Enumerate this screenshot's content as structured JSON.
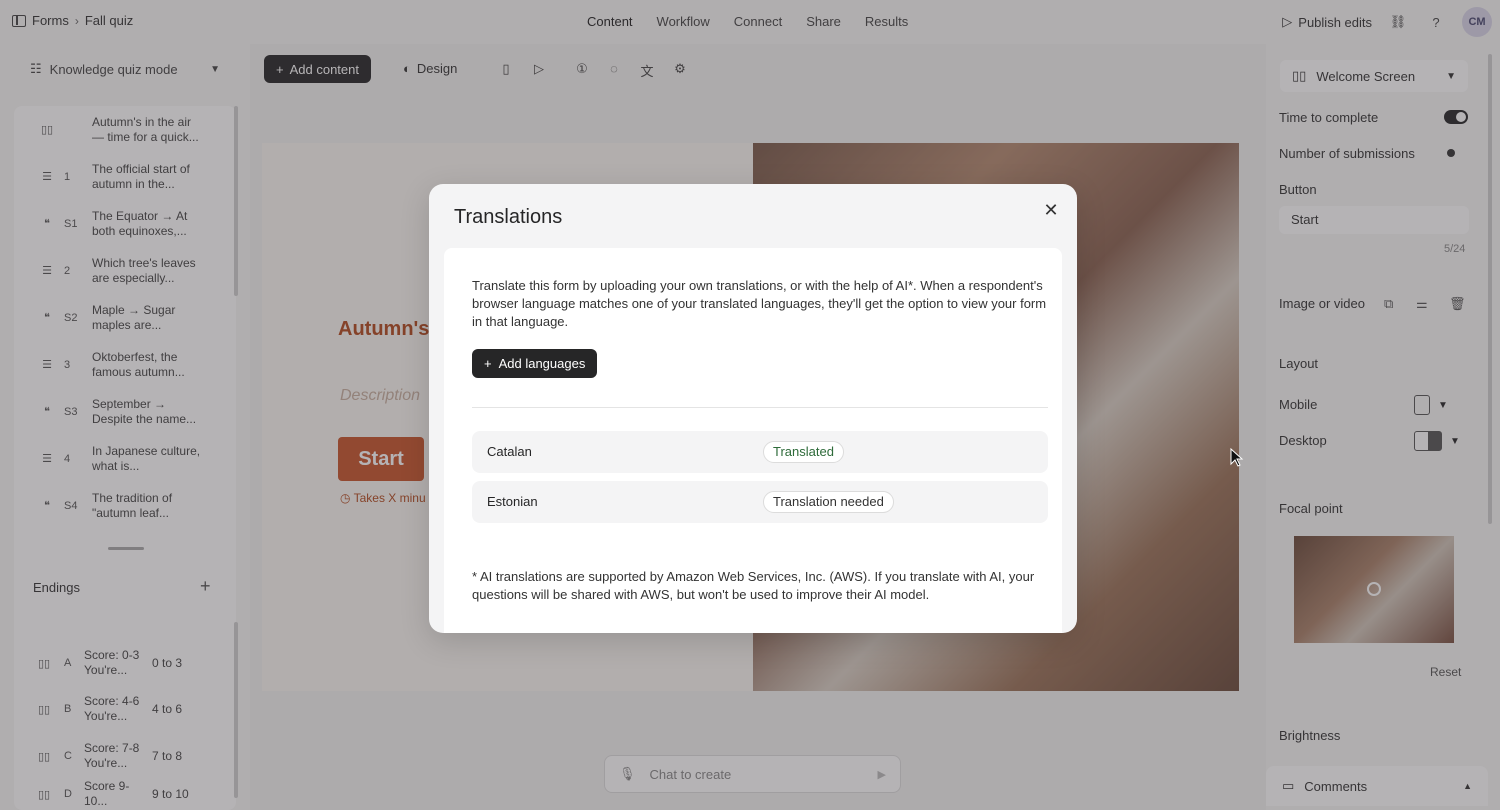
{
  "topbar": {
    "breadcrumb_root": "Forms",
    "breadcrumb_current": "Fall quiz",
    "tabs": [
      {
        "label": "Content"
      },
      {
        "label": "Workflow"
      },
      {
        "label": "Connect"
      },
      {
        "label": "Share"
      },
      {
        "label": "Results"
      }
    ],
    "publish_label": "Publish edits",
    "avatar_initials": "CM"
  },
  "sidebar": {
    "mode_label": "Knowledge quiz mode",
    "questions": [
      {
        "icon": "welcome-icon",
        "num": "",
        "text": "Autumn's in the air — time for a quick..."
      },
      {
        "icon": "list-icon",
        "num": "1",
        "text": "The official start of autumn in the..."
      },
      {
        "icon": "quote-icon",
        "num": "S1",
        "text": "The Equator → At both equinoxes,..."
      },
      {
        "icon": "list-icon",
        "num": "2",
        "text": "Which tree's leaves are especially..."
      },
      {
        "icon": "quote-icon",
        "num": "S2",
        "text": "Maple → Sugar maples are..."
      },
      {
        "icon": "list-icon",
        "num": "3",
        "text": "Oktoberfest, the famous autumn..."
      },
      {
        "icon": "quote-icon",
        "num": "S3",
        "text": "September → Despite the name..."
      },
      {
        "icon": "list-icon",
        "num": "4",
        "text": "In Japanese culture, what is..."
      },
      {
        "icon": "quote-icon",
        "num": "S4",
        "text": "The tradition of \"autumn leaf..."
      }
    ],
    "endings_label": "Endings",
    "endings": [
      {
        "letter": "A",
        "text": "Score: 0-3 You're...",
        "range": "0 to 3"
      },
      {
        "letter": "B",
        "text": "Score: 4-6 You're...",
        "range": "4 to 6"
      },
      {
        "letter": "C",
        "text": "Score: 7-8 You're...",
        "range": "7 to 8"
      },
      {
        "letter": "D",
        "text": "Score 9-10...",
        "range": "9 to 10"
      }
    ]
  },
  "toolbar": {
    "add_content_label": "Add content",
    "design_label": "Design"
  },
  "canvas": {
    "title": "Autumn's in the air — time for a quick ha",
    "description_placeholder": "Description",
    "start_label": "Start",
    "takes_label": "Takes X minu"
  },
  "chat": {
    "placeholder": "Chat to create"
  },
  "right_panel": {
    "screen_select": "Welcome Screen",
    "time_to_complete": "Time to complete",
    "number_of_submissions": "Number of submissions",
    "button_label": "Button",
    "button_value": "Start",
    "button_counter": "5/24",
    "image_or_video": "Image or video",
    "layout_label": "Layout",
    "mobile_label": "Mobile",
    "desktop_label": "Desktop",
    "focal_point_label": "Focal point",
    "reset_label": "Reset",
    "brightness_label": "Brightness",
    "comments_label": "Comments"
  },
  "modal": {
    "title": "Translations",
    "intro": "Translate this form by uploading your own translations, or with the help of AI*. When a respondent's browser language matches one of your translated languages, they'll get the option to view your form in that language.",
    "add_languages_label": "Add languages",
    "languages": [
      {
        "name": "Catalan",
        "status": "Translated",
        "status_color": "#2e6b3a"
      },
      {
        "name": "Estonian",
        "status": "Translation needed",
        "status_color": "#333333"
      }
    ],
    "footnote": "* AI translations are supported by Amazon Web Services, Inc. (AWS). If you translate with AI, your questions will be shared with AWS, but won't be used to improve their AI model."
  }
}
